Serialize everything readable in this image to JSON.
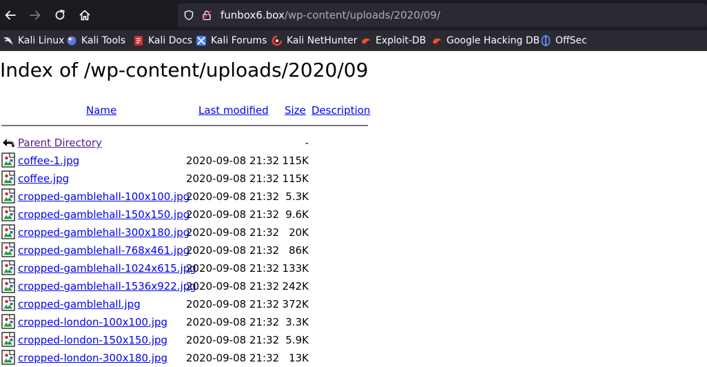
{
  "browser": {
    "url_host": "funbox6.box",
    "url_path": "/wp-content/uploads/2020/09/",
    "nav": {
      "back_icon": "arrow-left-icon",
      "forward_icon": "arrow-right-icon",
      "reload_icon": "reload-icon",
      "home_icon": "home-icon"
    },
    "bookmarks": [
      {
        "label": "Kali Linux",
        "icon": "kali-dragon-icon",
        "color": "#e8e8e8"
      },
      {
        "label": "Kali Tools",
        "icon": "kali-tools-icon",
        "color": "#3b82f6"
      },
      {
        "label": "Kali Docs",
        "icon": "kali-docs-icon",
        "color": "#d32f2f"
      },
      {
        "label": "Kali Forums",
        "icon": "kali-forums-icon",
        "color": "#3b82f6"
      },
      {
        "label": "Kali NetHunter",
        "icon": "nethunter-icon",
        "color": "#e53935"
      },
      {
        "label": "Exploit-DB",
        "icon": "exploit-db-icon",
        "color": "#f4511e"
      },
      {
        "label": "Google Hacking DB",
        "icon": "ghdb-icon",
        "color": "#f4511e"
      },
      {
        "label": "OffSec",
        "icon": "offsec-icon",
        "color": "#4f7bff"
      }
    ]
  },
  "page": {
    "title": "Index of /wp-content/uploads/2020/09",
    "columns": {
      "name": "Name",
      "last_modified": "Last modified",
      "size": "Size",
      "description": "Description"
    },
    "parent": {
      "name": "Parent Directory",
      "size": "-",
      "icon": "back-arrow-icon"
    },
    "files": [
      {
        "name": "coffee-1.jpg",
        "date": "2020-09-08 21:32",
        "size": "115K"
      },
      {
        "name": "coffee.jpg",
        "date": "2020-09-08 21:32",
        "size": "115K"
      },
      {
        "name": "cropped-gamblehall-100x100.jpg",
        "date": "2020-09-08 21:32",
        "size": "5.3K"
      },
      {
        "name": "cropped-gamblehall-150x150.jpg",
        "date": "2020-09-08 21:32",
        "size": "9.6K"
      },
      {
        "name": "cropped-gamblehall-300x180.jpg",
        "date": "2020-09-08 21:32",
        "size": "20K"
      },
      {
        "name": "cropped-gamblehall-768x461.jpg",
        "date": "2020-09-08 21:32",
        "size": "86K"
      },
      {
        "name": "cropped-gamblehall-1024x615.jpg",
        "date": "2020-09-08 21:32",
        "size": "133K"
      },
      {
        "name": "cropped-gamblehall-1536x922.jpg",
        "date": "2020-09-08 21:32",
        "size": "242K"
      },
      {
        "name": "cropped-gamblehall.jpg",
        "date": "2020-09-08 21:32",
        "size": "372K"
      },
      {
        "name": "cropped-london-100x100.jpg",
        "date": "2020-09-08 21:32",
        "size": "3.3K"
      },
      {
        "name": "cropped-london-150x150.jpg",
        "date": "2020-09-08 21:32",
        "size": "5.9K"
      },
      {
        "name": "cropped-london-300x180.jpg",
        "date": "2020-09-08 21:32",
        "size": "13K"
      }
    ],
    "file_icon": "image-file-icon"
  }
}
